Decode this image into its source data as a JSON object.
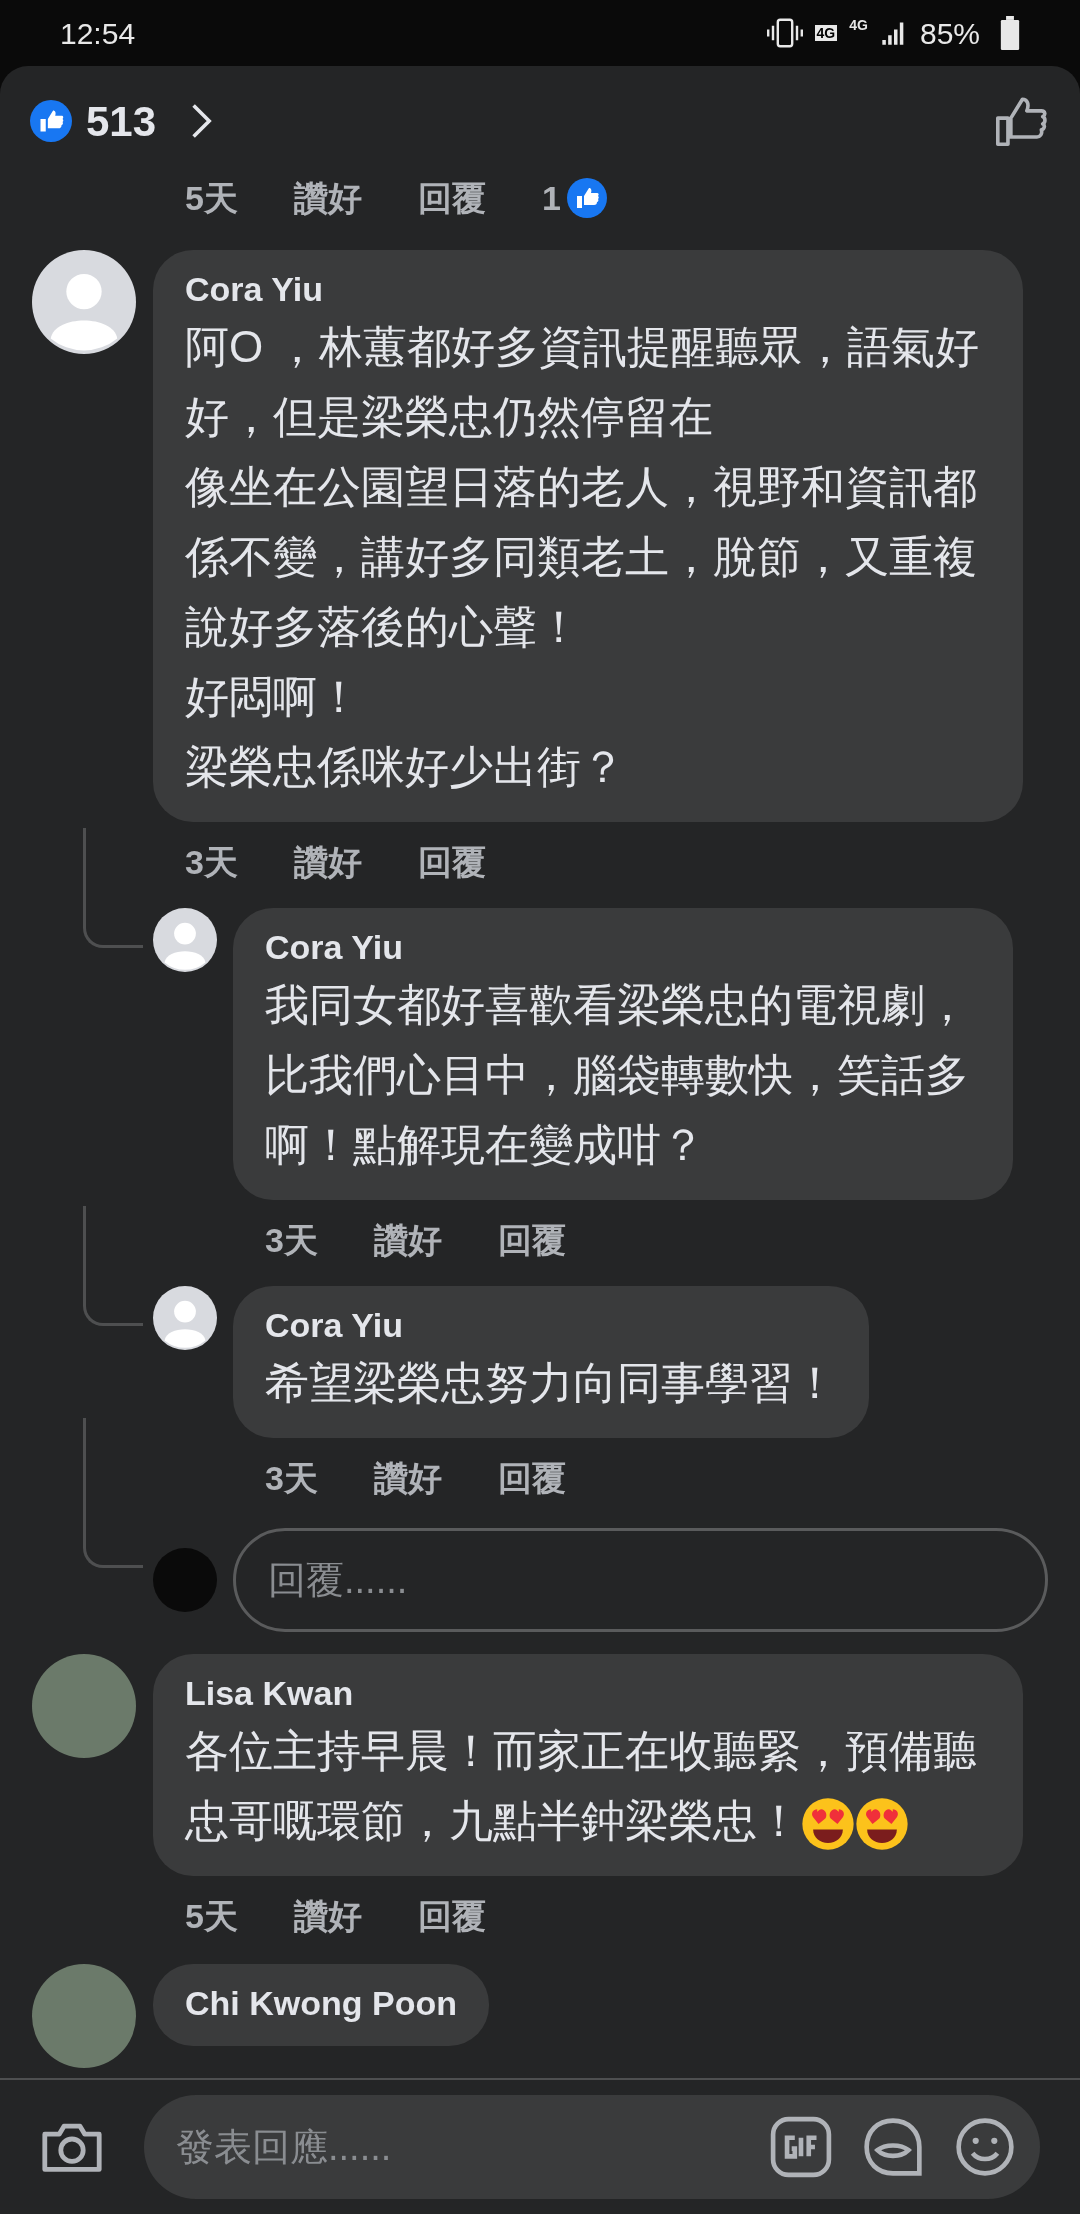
{
  "status_bar": {
    "time": "12:54",
    "networks": [
      "4G",
      "4G"
    ],
    "battery": "85%"
  },
  "header": {
    "reaction_count": "513"
  },
  "previous_meta": {
    "time": "5天",
    "like": "讚好",
    "reply": "回覆",
    "reactions": "1"
  },
  "comments": [
    {
      "author": "Cora Yiu",
      "kind": "generic",
      "paragraphs": [
        "阿O ，林蕙都好多資訊提醒聽眾，語氣好好，但是梁榮忠仍然停留在",
        "像坐在公園望日落的老人，視野和資訊都係不變，講好多同類老土，脫節，又重複說好多落後的心聲！",
        "好悶啊！",
        "梁榮忠係咪好少出街？"
      ],
      "time": "3天",
      "like": "讚好",
      "reply": "回覆",
      "replies": [
        {
          "author": "Cora Yiu",
          "text": "我同女都好喜歡看梁榮忠的電視劇，比我們心目中，腦袋轉數快，笑話多啊！點解現在變成咁？",
          "time": "3天",
          "like": "讚好",
          "reply": "回覆"
        },
        {
          "author": "Cora Yiu",
          "text": "希望梁榮忠努力向同事學習！",
          "time": "3天",
          "like": "讚好",
          "reply": "回覆"
        }
      ],
      "reply_box": {
        "placeholder": "回覆......"
      }
    },
    {
      "author": "Lisa Kwan",
      "kind": "photo",
      "text": "各位主持早晨！而家正在收聽緊，預備聽忠哥嘅環節，九點半鈡梁榮忠！",
      "emojis": [
        {
          "kind": "heart_eyes"
        },
        {
          "kind": "heart_eyes"
        }
      ],
      "time": "5天",
      "like": "讚好",
      "reply": "回覆"
    },
    {
      "author": "Chi Kwong Poon",
      "kind": "photo"
    }
  ],
  "composer": {
    "placeholder": "發表回應......"
  }
}
